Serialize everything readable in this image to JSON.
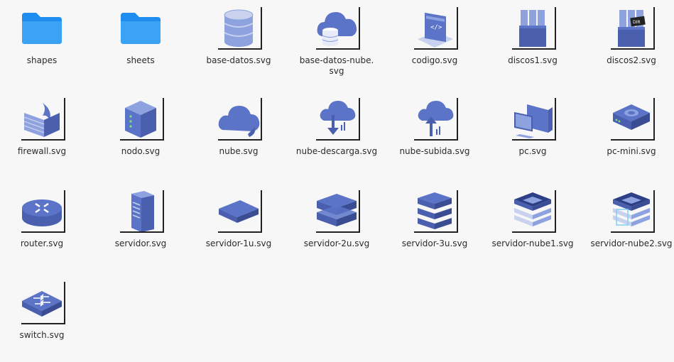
{
  "files": [
    {
      "name": "shapes",
      "icon": "folder-icon"
    },
    {
      "name": "sheets",
      "icon": "folder-icon"
    },
    {
      "name": "base-datos.svg",
      "icon": "database-icon"
    },
    {
      "name": "base-datos-nube.\nsvg",
      "icon": "cloud-database-icon"
    },
    {
      "name": "codigo.svg",
      "icon": "code-window-icon"
    },
    {
      "name": "discos1.svg",
      "icon": "disks-icon"
    },
    {
      "name": "discos2.svg",
      "icon": "disks-dir-icon"
    },
    {
      "name": "firewall.svg",
      "icon": "firewall-icon"
    },
    {
      "name": "nodo.svg",
      "icon": "node-server-icon"
    },
    {
      "name": "nube.svg",
      "icon": "cloud-icon"
    },
    {
      "name": "nube-descarga.svg",
      "icon": "cloud-download-icon"
    },
    {
      "name": "nube-subida.svg",
      "icon": "cloud-upload-icon"
    },
    {
      "name": "pc.svg",
      "icon": "pc-icon"
    },
    {
      "name": "pc-mini.svg",
      "icon": "mini-pc-icon"
    },
    {
      "name": "router.svg",
      "icon": "router-icon"
    },
    {
      "name": "servidor.svg",
      "icon": "tower-server-icon"
    },
    {
      "name": "servidor-1u.svg",
      "icon": "server-1u-icon"
    },
    {
      "name": "servidor-2u.svg",
      "icon": "server-2u-icon"
    },
    {
      "name": "servidor-3u.svg",
      "icon": "server-3u-icon"
    },
    {
      "name": "servidor-nube1.svg",
      "icon": "cloud-server1-icon"
    },
    {
      "name": "servidor-nube2.svg",
      "icon": "cloud-server2-icon"
    },
    {
      "name": "switch.svg",
      "icon": "switch-icon"
    }
  ],
  "colors": {
    "folder": "#1f8cef",
    "icon_dark": "#4a5fae",
    "icon_mid": "#5b74c8",
    "icon_light": "#8ea2e0",
    "icon_pale": "#c8d2ee",
    "background": "#f7f7f7"
  }
}
